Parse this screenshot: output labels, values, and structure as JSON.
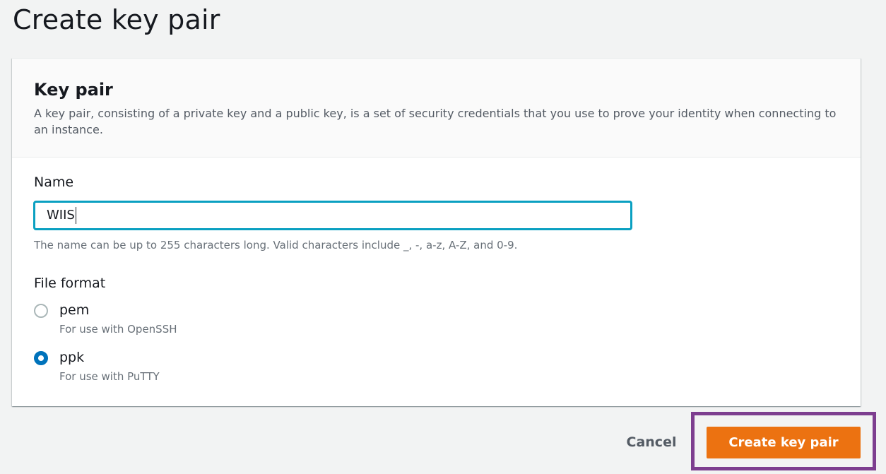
{
  "page": {
    "title": "Create key pair"
  },
  "panel": {
    "title": "Key pair",
    "description": "A key pair, consisting of a private key and a public key, is a set of security credentials that you use to prove your identity when connecting to an instance."
  },
  "name_field": {
    "label": "Name",
    "value": "WIIS",
    "hint": "The name can be up to 255 characters long. Valid characters include _, -, a-z, A-Z, and 0-9."
  },
  "file_format": {
    "label": "File format",
    "options": [
      {
        "label": "pem",
        "description": "For use with OpenSSH",
        "selected": false
      },
      {
        "label": "ppk",
        "description": "For use with PuTTY",
        "selected": true
      }
    ]
  },
  "actions": {
    "cancel_label": "Cancel",
    "create_label": "Create key pair"
  },
  "colors": {
    "accent": "#ec7211",
    "focus": "#0aa0c1",
    "radio_selected": "#0073bb",
    "highlight": "#7d3e8f"
  }
}
